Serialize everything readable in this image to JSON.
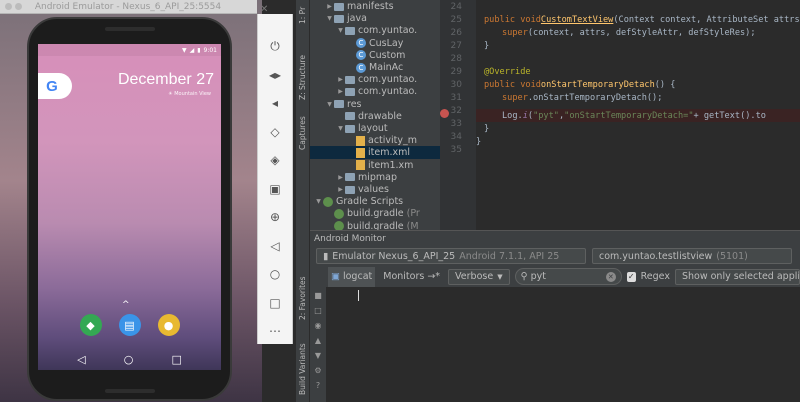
{
  "emulator": {
    "title": "Android Emulator - Nexus_6_API_25:5554",
    "status_time": "9:01",
    "google_logo": "G",
    "date": "December 27",
    "weather_line": "☀ Mountain View",
    "up_arrow": "^",
    "dock_apps": [
      {
        "name": "maps-icon",
        "color": "#34a853",
        "glyph": "◆"
      },
      {
        "name": "messages-icon",
        "color": "#3a94e8",
        "glyph": "▤"
      },
      {
        "name": "chrome-icon",
        "color": "#e8b931",
        "glyph": "●"
      }
    ],
    "nav": {
      "back": "◁",
      "home": "○",
      "recents": "□"
    },
    "toolbar": {
      "close": "✕",
      "buttons": [
        {
          "name": "power-icon",
          "glyph": "⏻"
        },
        {
          "name": "volume-up-icon",
          "glyph": "◂▸"
        },
        {
          "name": "volume-down-icon",
          "glyph": "◂"
        },
        {
          "name": "rotate-left-icon",
          "glyph": "◇"
        },
        {
          "name": "rotate-right-icon",
          "glyph": "◈"
        },
        {
          "name": "camera-icon",
          "glyph": "▣"
        },
        {
          "name": "zoom-icon",
          "glyph": "⊕"
        },
        {
          "name": "back-icon",
          "glyph": "◁"
        },
        {
          "name": "home-icon",
          "glyph": "○"
        },
        {
          "name": "overview-icon",
          "glyph": "□"
        },
        {
          "name": "more-icon",
          "glyph": "⋯"
        }
      ]
    }
  },
  "side_labels": {
    "structure": "Z: Structure",
    "captures": "Captures",
    "favorites": "2: Favorites",
    "build_variants": "Build Variants",
    "project": "1: Pr"
  },
  "tree": [
    {
      "indent": 0,
      "kind": "folder",
      "label": "manifests",
      "arrow": "▶"
    },
    {
      "indent": 0,
      "kind": "folder",
      "label": "java",
      "arrow": "▼"
    },
    {
      "indent": 1,
      "kind": "folder",
      "label": "com.yuntao.",
      "arrow": "▼"
    },
    {
      "indent": 2,
      "kind": "class",
      "label": "CusLay",
      "arrow": ""
    },
    {
      "indent": 2,
      "kind": "class",
      "label": "Custom",
      "arrow": ""
    },
    {
      "indent": 2,
      "kind": "class",
      "label": "MainAc",
      "arrow": ""
    },
    {
      "indent": 1,
      "kind": "folder",
      "label": "com.yuntao.",
      "arrow": "▶"
    },
    {
      "indent": 1,
      "kind": "folder",
      "label": "com.yuntao.",
      "arrow": "▶"
    },
    {
      "indent": 0,
      "kind": "folder",
      "label": "res",
      "arrow": "▼"
    },
    {
      "indent": 1,
      "kind": "folder",
      "label": "drawable",
      "arrow": ""
    },
    {
      "indent": 1,
      "kind": "folder",
      "label": "layout",
      "arrow": "▼"
    },
    {
      "indent": 2,
      "kind": "xml",
      "label": "activity_m",
      "arrow": ""
    },
    {
      "indent": 2,
      "kind": "xml",
      "label": "item.xml",
      "arrow": "",
      "selected": true
    },
    {
      "indent": 2,
      "kind": "xml",
      "label": "item1.xm",
      "arrow": ""
    },
    {
      "indent": 1,
      "kind": "folder",
      "label": "mipmap",
      "arrow": "▶"
    },
    {
      "indent": 1,
      "kind": "folder",
      "label": "values",
      "arrow": "▶"
    },
    {
      "indent": -1,
      "kind": "gradle",
      "label": "Gradle Scripts",
      "arrow": "▼"
    },
    {
      "indent": 0,
      "kind": "gradle",
      "label": "build.gradle",
      "suffix": "(Pr",
      "arrow": ""
    },
    {
      "indent": 0,
      "kind": "gradle",
      "label": "build.gradle",
      "suffix": "(M",
      "arrow": ""
    }
  ],
  "gutter": [
    "24",
    "25",
    "26",
    "27",
    "28",
    "29",
    "30",
    "31",
    "32",
    "33",
    "34",
    "35"
  ],
  "code": {
    "l25": [
      "public void ",
      "CustomTextView",
      "(Context context, AttributeSet attrs"
    ],
    "l26": [
      "super",
      "(context, attrs, defStyleAttr, defStyleRes);"
    ],
    "l27": "}",
    "l29": "@Override",
    "l30": [
      "public void ",
      "onStartTemporaryDetach",
      "() {"
    ],
    "l31": [
      "super",
      ".onStartTemporaryDetach();"
    ],
    "l32": [
      "Log.",
      "i",
      "(",
      "\"pyt\"",
      ", ",
      "\"onStartTemporaryDetach=\"",
      " + getText().to"
    ],
    "l33": "}",
    "l34": "}"
  },
  "monitor": {
    "title": "Android Monitor",
    "device": "Emulator Nexus_6_API_25",
    "device_detail": "Android 7.1.1, API 25",
    "process": "com.yuntao.testlistview",
    "pid": "(5101)",
    "tab_logcat": "logcat",
    "tab_monitors": "Monitors",
    "tab_monitors_arrow": "→*",
    "level": "Verbose",
    "search_value": "pyt",
    "regex_label": "Regex",
    "filter": "Show only selected applicatio"
  }
}
